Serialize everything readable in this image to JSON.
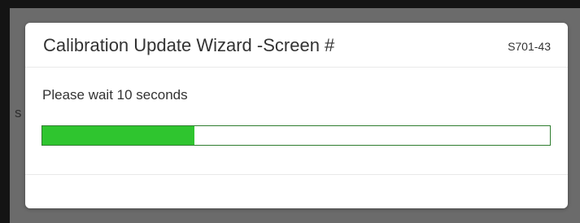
{
  "background": {
    "partial_text": "s"
  },
  "dialog": {
    "title": "Calibration Update Wizard -Screen #",
    "screen_code": "S701-43",
    "message": "Please wait 10 seconds",
    "progress": {
      "fraction": 0.3,
      "fill_color": "#2fc52f",
      "border_color": "#2f7d2f"
    }
  }
}
